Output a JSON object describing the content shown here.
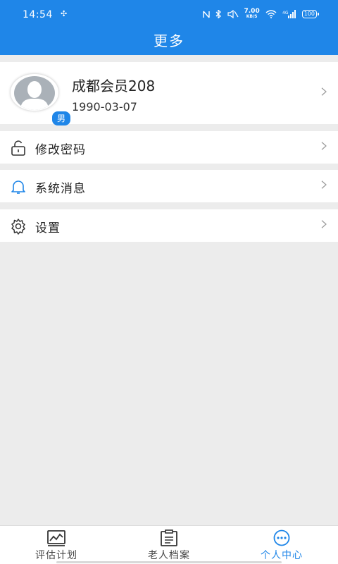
{
  "status_bar": {
    "time": "14:54",
    "speed_value": "7.00",
    "speed_unit": "KB/S",
    "battery": "100"
  },
  "header": {
    "title": "更多"
  },
  "profile": {
    "name": "成都会员208",
    "birthdate": "1990-03-07",
    "gender": "男"
  },
  "menu": {
    "items": [
      {
        "label": "修改密码",
        "icon": "lock-icon"
      },
      {
        "label": "系统消息",
        "icon": "bell-icon"
      },
      {
        "label": "设置",
        "icon": "gear-icon"
      }
    ]
  },
  "tabbar": {
    "tabs": [
      {
        "label": "评估计划",
        "icon": "chart-icon"
      },
      {
        "label": "老人档案",
        "icon": "clipboard-icon"
      },
      {
        "label": "个人中心",
        "icon": "more-icon",
        "active": true
      }
    ]
  },
  "colors": {
    "accent": "#1f86e8",
    "background": "#ececec"
  }
}
